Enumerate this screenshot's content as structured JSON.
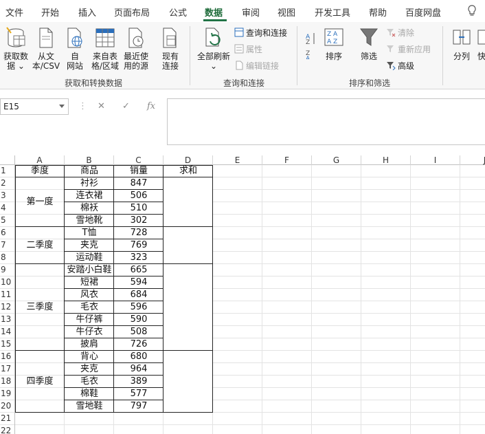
{
  "menu": {
    "items": [
      "文件",
      "开始",
      "插入",
      "页面布局",
      "公式",
      "数据",
      "审阅",
      "视图",
      "开发工具",
      "帮助",
      "百度网盘"
    ],
    "active": "数据",
    "help_icon": "lightbulb-icon"
  },
  "ribbon": {
    "get_data": "获取数\n据 ⌄",
    "from_text": "从文\n本/CSV",
    "from_web": "自\n网站",
    "from_table": "来自表\n格/区域",
    "recent_sources": "最近使\n用的源",
    "existing_connections": "现有\n连接",
    "group1_label": "获取和转换数据",
    "refresh_all": "全部刷新\n⌄",
    "queries_connections": "查询和连接",
    "properties": "属性",
    "edit_links": "编辑链接",
    "group2_label": "查询和连接",
    "sort": "排序",
    "filter": "筛选",
    "clear": "清除",
    "reapply": "重新应用",
    "advanced": "高级",
    "group3_label": "排序和筛选",
    "split": "分列",
    "quick_fill": "快"
  },
  "formula_bar": {
    "name_box": "E15",
    "cancel": "✕",
    "enter": "✓",
    "fx": "fx",
    "formula": ""
  },
  "sheet": {
    "columns": [
      "A",
      "B",
      "C",
      "D",
      "E",
      "F",
      "G",
      "H",
      "I",
      "J"
    ],
    "rows": [
      "1",
      "2",
      "3",
      "4",
      "5",
      "6",
      "7",
      "8",
      "9",
      "10",
      "11",
      "12",
      "13",
      "14",
      "15",
      "16",
      "17",
      "18",
      "19",
      "20",
      "21",
      "22"
    ],
    "header": {
      "season": "季度",
      "product": "商品",
      "sales": "销量",
      "sum": "求和"
    },
    "seasons": [
      "第一度",
      "二季度",
      "三季度",
      "四季度"
    ],
    "products": [
      "衬衫",
      "连衣裙",
      "棉袄",
      "雪地靴",
      "T恤",
      "夹克",
      "运动鞋",
      "安踏小白鞋",
      "短裙",
      "风衣",
      "毛衣",
      "牛仔裤",
      "牛仔衣",
      "披肩",
      "背心",
      "夹克",
      "毛衣",
      "棉鞋",
      "雪地鞋"
    ],
    "sales": [
      "847",
      "506",
      "510",
      "302",
      "728",
      "769",
      "323",
      "665",
      "594",
      "684",
      "596",
      "590",
      "508",
      "726",
      "680",
      "964",
      "389",
      "577",
      "797"
    ]
  }
}
